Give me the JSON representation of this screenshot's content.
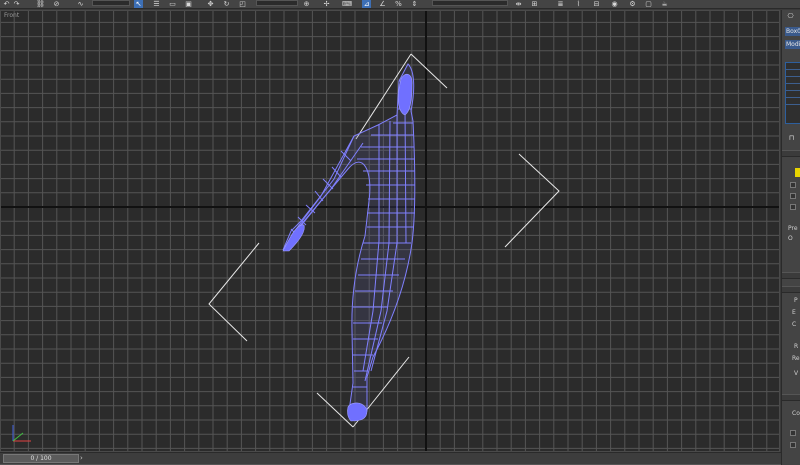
{
  "viewport": {
    "label": "Front",
    "grid_color": "#555555",
    "mesh_color": "#8080ff",
    "axis_colors": {
      "x": "#e04040",
      "y": "#40c040",
      "z": "#4060e0"
    }
  },
  "toolbar": {
    "icons": [
      "undo-icon",
      "redo-icon",
      "link-icon",
      "unlink-icon",
      "bind-icon",
      "select-filter-dropdown",
      "select-icon",
      "select-by-name-icon",
      "rect-select-icon",
      "window-crossing-icon",
      "move-icon",
      "rotate-icon",
      "scale-icon",
      "reference-coord-dropdown",
      "pivot-icon",
      "manipulate-icon",
      "keyboard-shortcut-icon",
      "snap-icon",
      "angle-snap-icon",
      "percent-snap-icon",
      "spinner-snap-icon",
      "named-selection-dropdown",
      "mirror-icon",
      "align-icon",
      "layer-manager-icon",
      "curve-editor-icon",
      "schematic-icon",
      "material-editor-icon",
      "render-setup-icon",
      "render-frame-icon",
      "render-icon"
    ]
  },
  "command_panel": {
    "object_name": "Box0",
    "modifier_list_label": "Modi",
    "preview_label": "Pre",
    "radio_label": "O",
    "labels": [
      "P",
      "E",
      "C",
      "R",
      "Re",
      "V",
      "Co"
    ]
  },
  "time_slider": {
    "value": "0 / 100"
  }
}
